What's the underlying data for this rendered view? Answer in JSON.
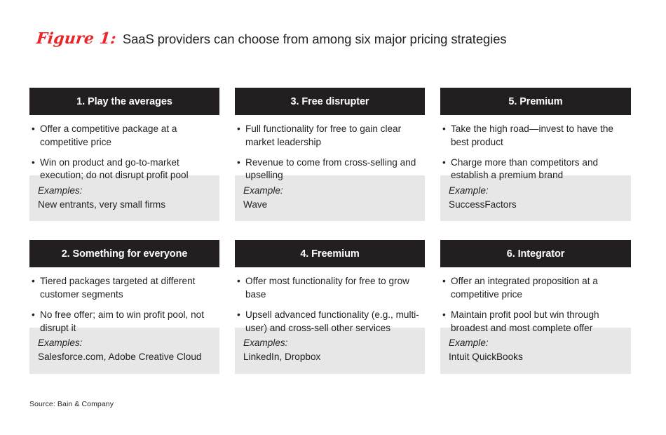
{
  "header": {
    "figure_label": "Figure 1:",
    "title": "SaaS providers can choose from among six major pricing strategies",
    "label_color": "#e8262a",
    "title_color": "#231f20"
  },
  "colors": {
    "card_header_bg": "#231f20",
    "card_header_text": "#ffffff",
    "example_box_bg": "#e7e7e7",
    "body_text": "#231f20",
    "page_bg": "#ffffff"
  },
  "cards": [
    {
      "number": "1",
      "title": "1. Play the averages",
      "bullets": [
        "Offer a competitive package at a competitive price",
        "Win on product and go-to-market execution; do not disrupt profit pool"
      ],
      "example_label": "Examples:",
      "example_value": "New entrants, very small firms"
    },
    {
      "number": "3",
      "title": "3. Free disrupter",
      "bullets": [
        "Full functionality for free to gain clear market leadership",
        "Revenue to come from cross-selling and upselling"
      ],
      "example_label": "Example:",
      "example_value": "Wave"
    },
    {
      "number": "5",
      "title": "5. Premium",
      "bullets": [
        "Take the high road—invest to have the best product",
        "Charge more than competitors and establish a premium brand"
      ],
      "example_label": "Example:",
      "example_value": "SuccessFactors"
    },
    {
      "number": "2",
      "title": "2. Something for everyone",
      "bullets": [
        "Tiered packages targeted at different customer segments",
        "No free offer; aim to win profit pool, not disrupt it"
      ],
      "example_label": "Examples:",
      "example_value": "Salesforce.com, Adobe Creative Cloud"
    },
    {
      "number": "4",
      "title": "4. Freemium",
      "bullets": [
        "Offer most functionality for free to grow base",
        "Upsell advanced functionality (e.g., multi-user) and cross-sell other services"
      ],
      "example_label": "Examples:",
      "example_value": "LinkedIn, Dropbox"
    },
    {
      "number": "6",
      "title": "6. Integrator",
      "bullets": [
        "Offer an integrated proposition at a competitive price",
        "Maintain profit pool but win through broadest and most complete offer"
      ],
      "example_label": "Example:",
      "example_value": "Intuit QuickBooks"
    }
  ],
  "bullet_glyph": "•",
  "footer": {
    "source": "Source: Bain & Company"
  }
}
